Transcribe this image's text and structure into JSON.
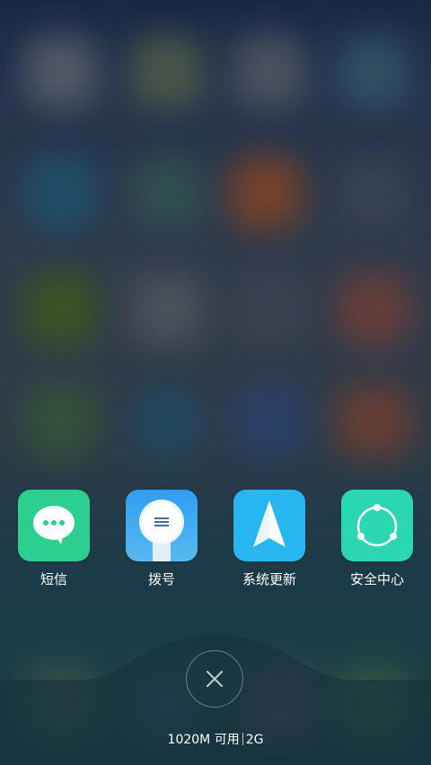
{
  "recent_apps": [
    {
      "label": "短信",
      "icon": "message-icon",
      "color": "#2ccf8f"
    },
    {
      "label": "拨号",
      "icon": "dialer-icon",
      "color": "#3aa6ef"
    },
    {
      "label": "系统更新",
      "icon": "system-update-icon",
      "color": "#27b6ef"
    },
    {
      "label": "安全中心",
      "icon": "security-center-icon",
      "color": "#2bd6b3"
    }
  ],
  "close_button": {
    "icon": "close-icon"
  },
  "memory": {
    "available": "1020M 可用",
    "total": "2G"
  },
  "colors": {
    "background_top": "#1b2b4c",
    "background_bottom": "#1c3e46",
    "text": "#ffffff"
  }
}
